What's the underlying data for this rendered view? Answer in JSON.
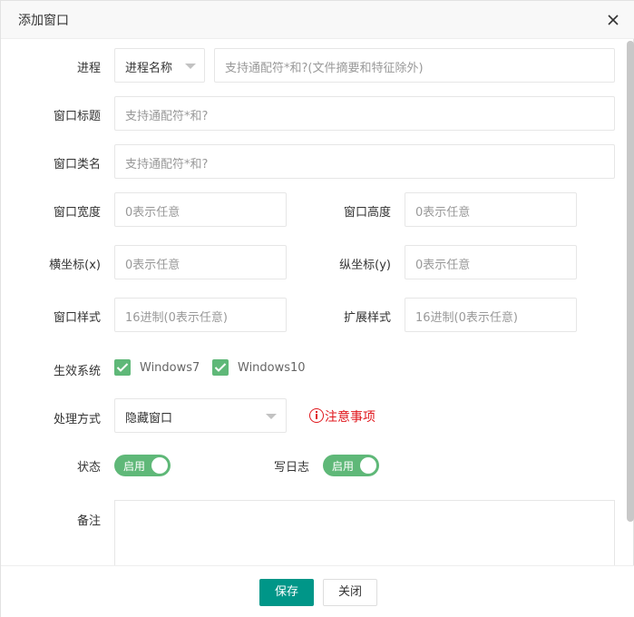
{
  "dialog": {
    "title": "添加窗口"
  },
  "form": {
    "process": {
      "label": "进程",
      "type_value": "进程名称",
      "placeholder": "支持通配符*和?(文件摘要和特征除外)"
    },
    "window_title": {
      "label": "窗口标题",
      "placeholder": "支持通配符*和?"
    },
    "window_class": {
      "label": "窗口类名",
      "placeholder": "支持通配符*和?"
    },
    "window_width": {
      "label": "窗口宽度",
      "placeholder": "0表示任意"
    },
    "window_height": {
      "label": "窗口高度",
      "placeholder": "0表示任意"
    },
    "x_coord": {
      "label": "横坐标(x)",
      "placeholder": "0表示任意"
    },
    "y_coord": {
      "label": "纵坐标(y)",
      "placeholder": "0表示任意"
    },
    "window_style": {
      "label": "窗口样式",
      "placeholder": "16进制(0表示任意)"
    },
    "ext_style": {
      "label": "扩展样式",
      "placeholder": "16进制(0表示任意)"
    },
    "effective_system": {
      "label": "生效系统",
      "options": [
        {
          "label": "Windows7",
          "checked": true
        },
        {
          "label": "Windows10",
          "checked": true
        }
      ]
    },
    "handling": {
      "label": "处理方式",
      "value": "隐藏窗口",
      "notice": "注意事项"
    },
    "status": {
      "label": "状态",
      "switch_text": "启用",
      "on": true
    },
    "write_log": {
      "label": "写日志",
      "switch_text": "启用",
      "on": true
    },
    "remark": {
      "label": "备注",
      "value": ""
    }
  },
  "footer": {
    "save_label": "保存",
    "close_label": "关闭"
  },
  "colors": {
    "accent": "#5fb878",
    "primary_button": "#009688",
    "notice": "#e0171d"
  },
  "icons": {
    "close": "close-icon",
    "caret": "caret-down-icon",
    "check": "check-icon",
    "notice": "info-circle-icon"
  }
}
